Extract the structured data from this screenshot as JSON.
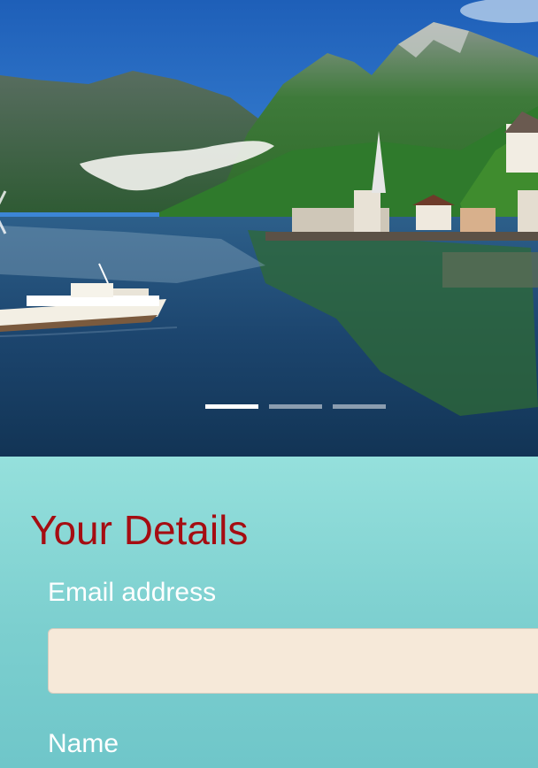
{
  "carousel": {
    "slide_count": 3,
    "active_index": 0,
    "prev_icon": "chevron-left-icon"
  },
  "form": {
    "title": "Your Details",
    "email_label": "Email address",
    "email_value": "",
    "name_label": "Name"
  },
  "colors": {
    "title": "#a50d12",
    "panel": "#7ccdcd",
    "input_bg": "#f6e9d9"
  }
}
